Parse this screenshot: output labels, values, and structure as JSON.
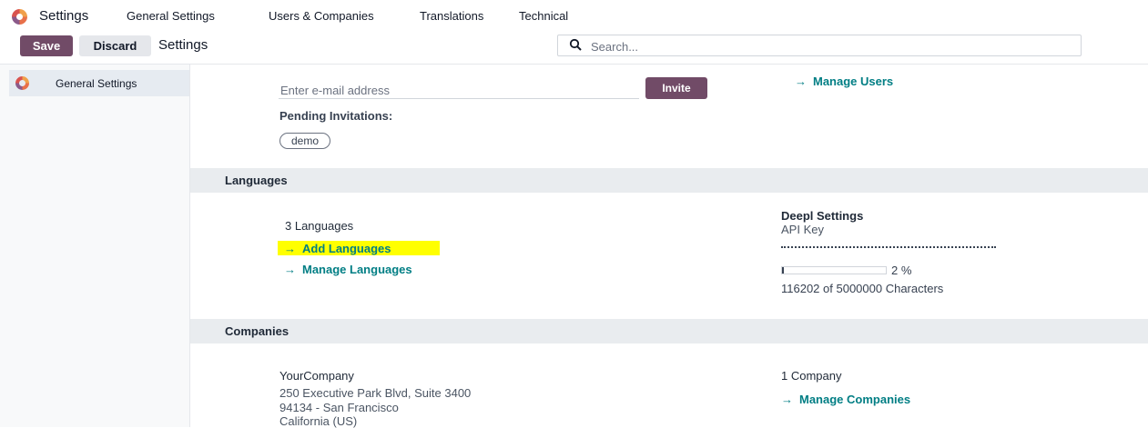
{
  "topnav": {
    "app_name": "Settings",
    "menu": [
      "General Settings",
      "Users & Companies",
      "Translations",
      "Technical"
    ]
  },
  "control_panel": {
    "save_label": "Save",
    "discard_label": "Discard",
    "breadcrumb": "Settings",
    "search_placeholder": "Search..."
  },
  "sidebar": {
    "items": [
      {
        "label": "General Settings"
      }
    ]
  },
  "users": {
    "invite_placeholder": "Enter e-mail address",
    "invite_label": "Invite",
    "pending_label": "Pending Invitations:",
    "pending": [
      "demo"
    ],
    "manage_users": "Manage Users"
  },
  "languages": {
    "header": "Languages",
    "count": "3 Languages",
    "add": "Add Languages",
    "manage": "Manage Languages",
    "deepl_title": "Deepl Settings",
    "api_key_label": "API Key",
    "usage_percent_text": "2 %",
    "usage_fraction": 0.02,
    "characters": "116202 of 5000000 Characters"
  },
  "companies": {
    "header": "Companies",
    "name": "YourCompany",
    "address_line1": "250 Executive Park Blvd, Suite 3400",
    "address_line2": "94134 - San Francisco",
    "address_line3": "California (US)",
    "count": "1 Company",
    "manage": "Manage Companies"
  },
  "colors": {
    "primary": "#714b67",
    "link": "#017e84",
    "highlight": "#ffff00"
  }
}
